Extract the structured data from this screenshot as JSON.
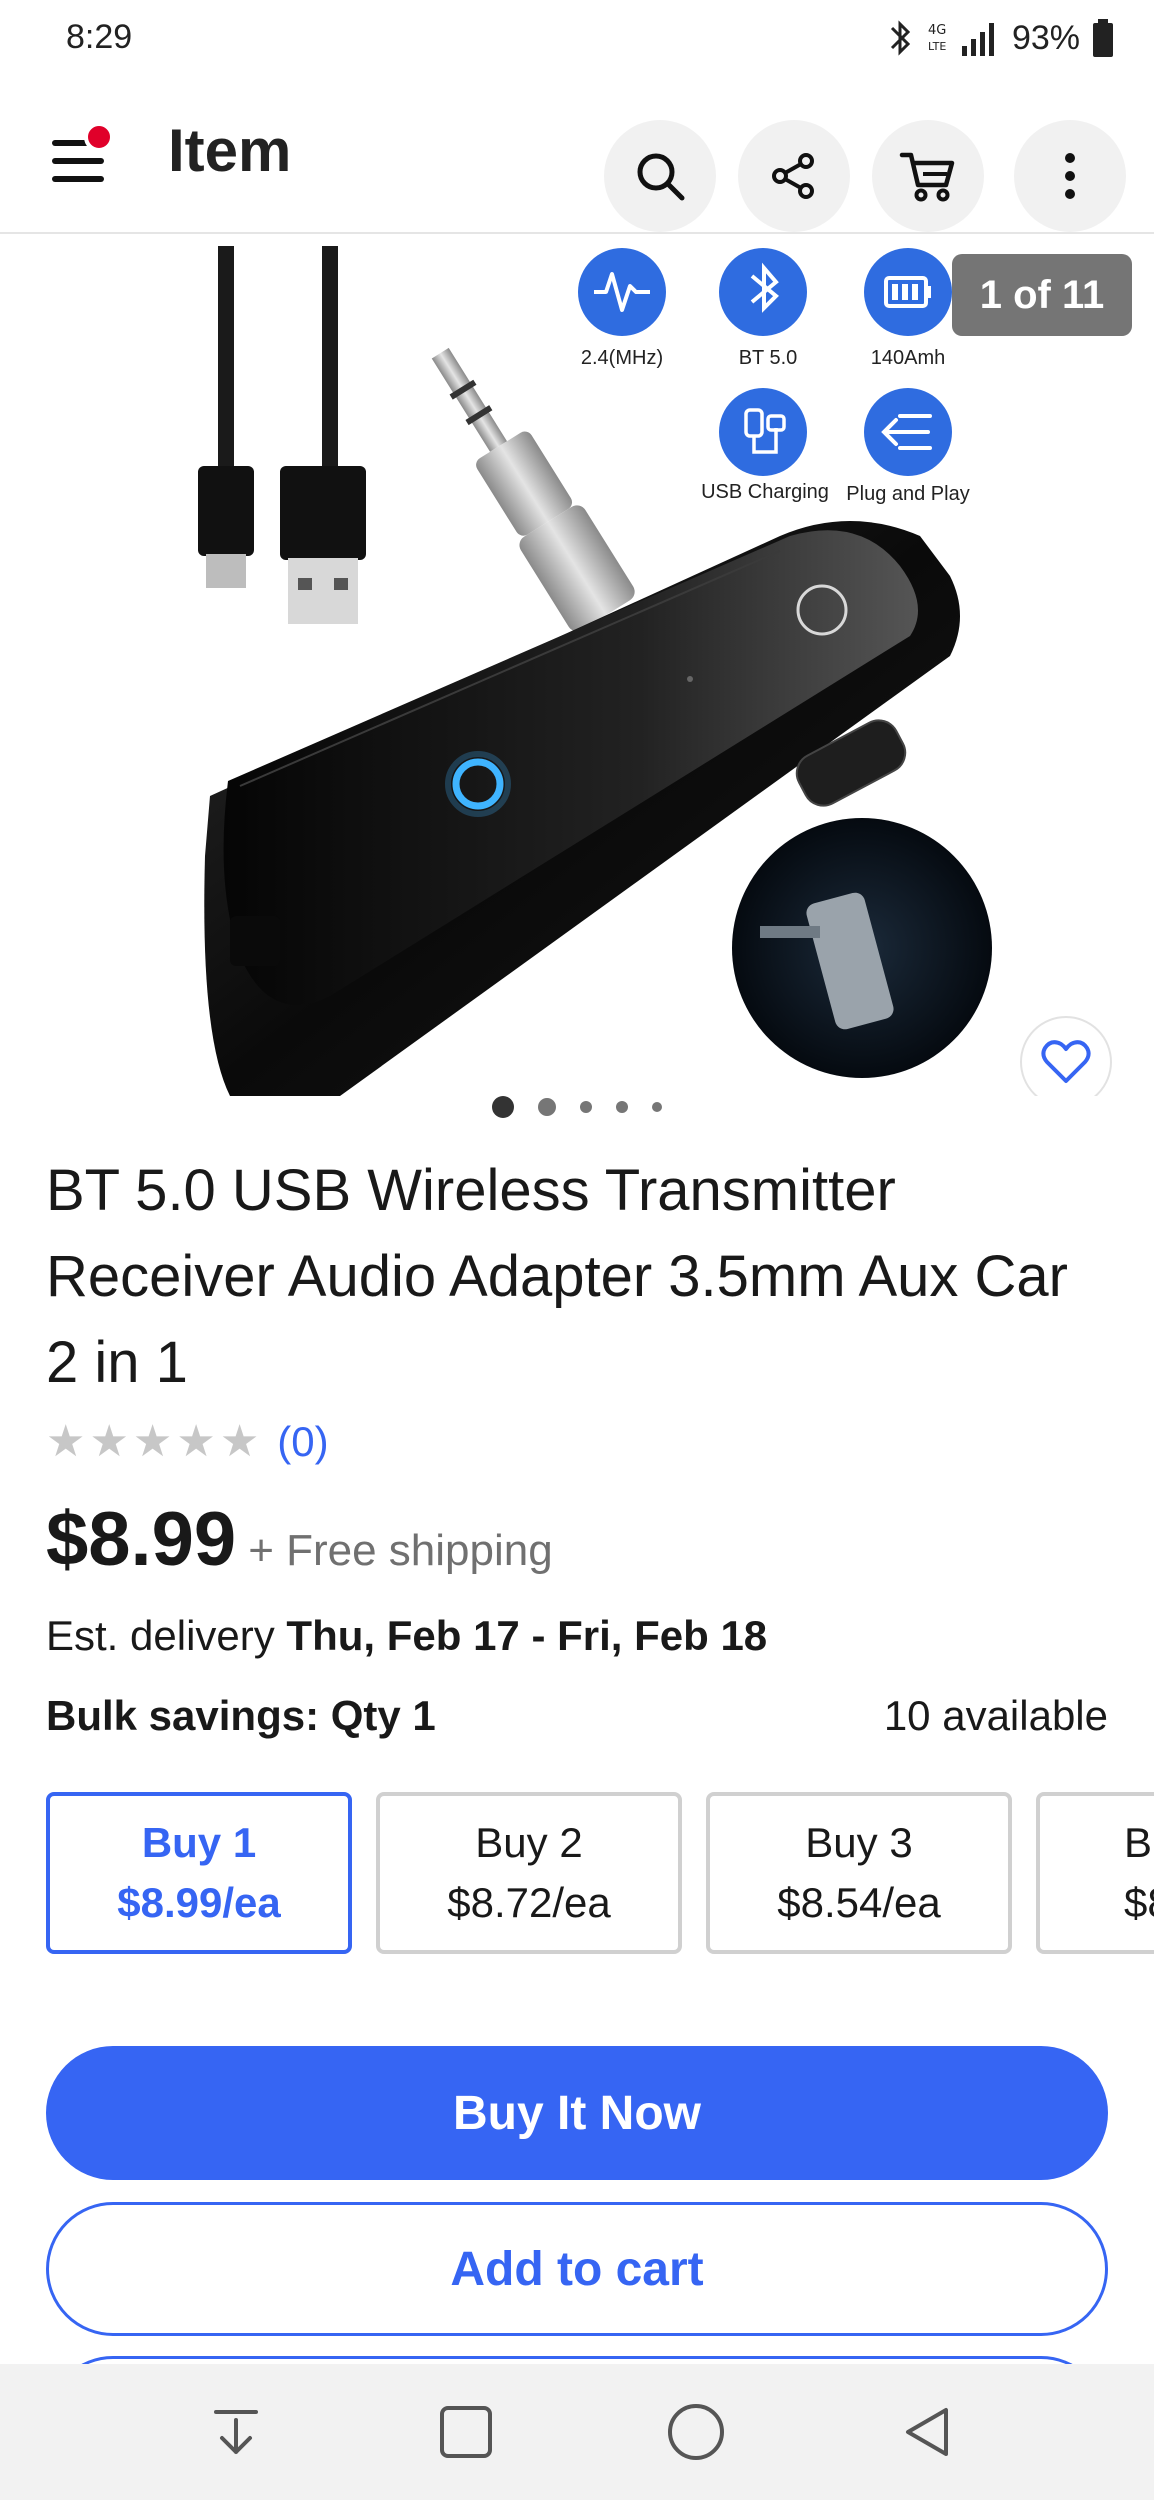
{
  "status_bar": {
    "time": "8:29",
    "battery_text": "93%",
    "icons": [
      "bluetooth-icon",
      "lte-icon",
      "signal-icon",
      "battery-icon"
    ]
  },
  "header": {
    "title": "Item",
    "icons": [
      "menu-icon",
      "search-icon",
      "share-icon",
      "cart-icon",
      "more-vert-icon"
    ],
    "notification_dot_color": "#e0002a"
  },
  "gallery": {
    "counter": "1 of 11",
    "features": [
      {
        "icon": "waveform-icon",
        "label": "2.4(MHz)"
      },
      {
        "icon": "bluetooth-icon",
        "label": "BT 5.0"
      },
      {
        "icon": "battery-icon",
        "label": "140Amh"
      },
      {
        "icon": "usb-charging-icon",
        "label": "USB Charging"
      },
      {
        "icon": "plug-play-icon",
        "label": "Plug and Play"
      }
    ],
    "active_dot": 1,
    "dot_count": 5
  },
  "product": {
    "title": "BT 5.0 USB Wireless Transmitter Receiver Audio Adapter 3.5mm Aux Car 2 in 1",
    "rating_stars": 0,
    "rating_count": "(0)",
    "price": "$8.99",
    "shipping": "+ Free shipping",
    "delivery_label": "Est. delivery",
    "delivery_dates": "Thu, Feb 17 - Fri, Feb 18",
    "bulk_label": "Bulk savings: Qty 1",
    "available": "10 available"
  },
  "bulk_options": [
    {
      "qty": "Buy 1",
      "price": "$8.99/ea",
      "selected": true
    },
    {
      "qty": "Buy 2",
      "price": "$8.72/ea",
      "selected": false
    },
    {
      "qty": "Buy 3",
      "price": "$8.54/ea",
      "selected": false
    },
    {
      "qty": "B",
      "price": "$8.",
      "selected": false
    }
  ],
  "actions": {
    "buy_now": "Buy It Now",
    "add_to_cart": "Add to cart"
  },
  "colors": {
    "accent": "#3665f3",
    "counter_bg": "#757575",
    "star_empty": "#c7c7c7"
  },
  "nav_bar": {
    "icons": [
      "recent-download-icon",
      "square-icon",
      "home-circle-icon",
      "back-triangle-icon"
    ]
  }
}
